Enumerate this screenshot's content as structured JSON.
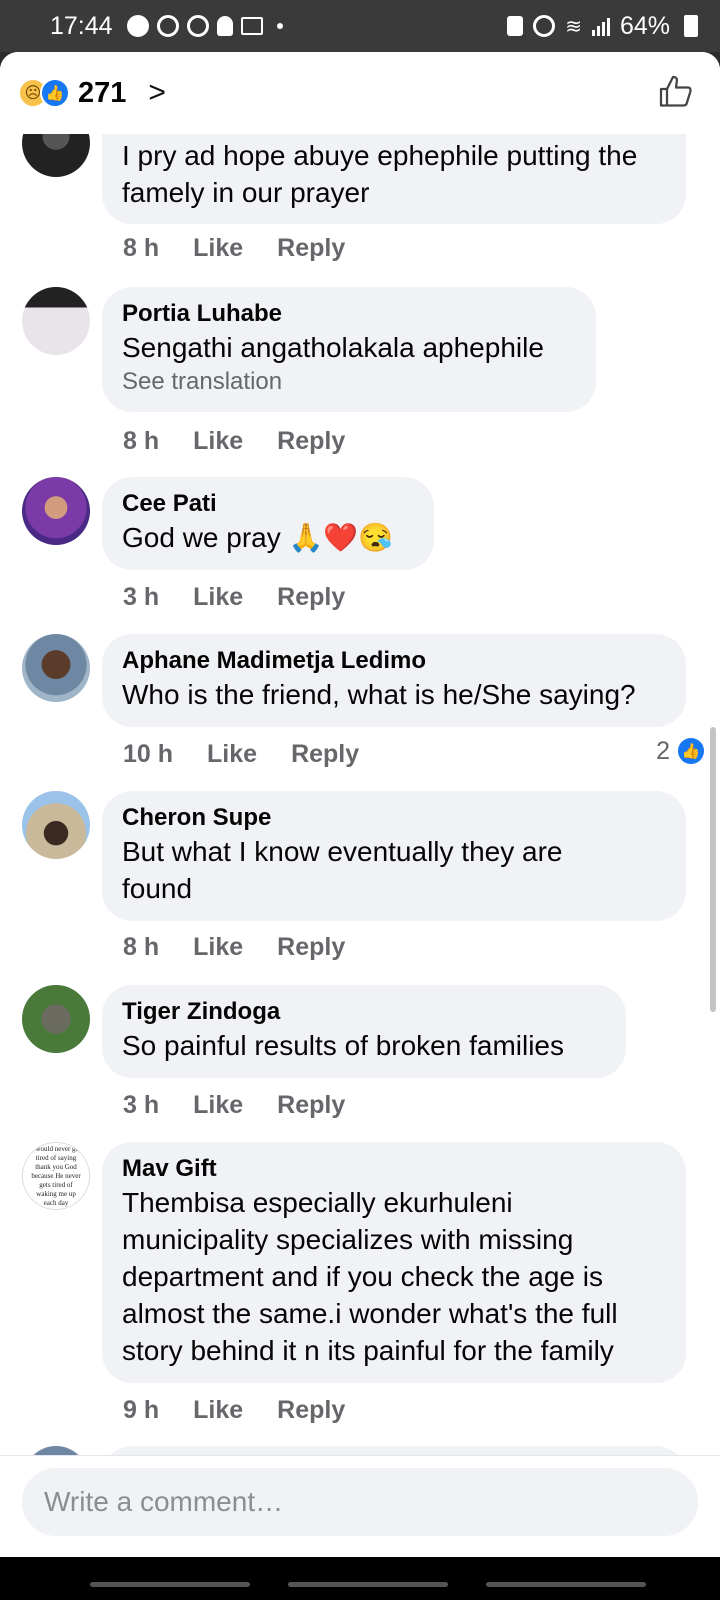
{
  "status_bar": {
    "time": "17:44",
    "battery": "64%"
  },
  "header": {
    "reaction_count": "271",
    "chevron": ">"
  },
  "comments": [
    {
      "author": "",
      "text": "I pry ad hope abuye ephephile putting the famely in our prayer",
      "time": "8 h"
    },
    {
      "author": "Portia Luhabe",
      "text": "Sengathi angatholakala aphephile",
      "see_translation": "See translation",
      "time": "8 h"
    },
    {
      "author": "Cee Pati",
      "text": "God we pray 🙏❤️😪",
      "time": "3 h"
    },
    {
      "author": "Aphane Madimetja Ledimo",
      "text": "Who is the friend, what is he/She saying?",
      "time": "10 h",
      "reactions": "2"
    },
    {
      "author": "Cheron Supe",
      "text": "But what I know eventually they are found",
      "time": "8 h"
    },
    {
      "author": "Tiger Zindoga",
      "text": "So painful results of broken families",
      "time": "3 h"
    },
    {
      "author": "Mav Gift",
      "text": "Thembisa especially ekurhuleni municipality specializes with missing department and if you check the age is almost the same.i wonder what's the full story behind it n its painful for the family",
      "time": "9 h",
      "avatar_text": "I would never get tired of saying thank you God because He never gets tired of waking me up each day"
    }
  ],
  "actions": {
    "like": "Like",
    "reply": "Reply"
  },
  "composer": {
    "placeholder": "Write a comment…"
  },
  "icons": [
    "sad-reaction-icon",
    "like-reaction-icon",
    "chevron-right-icon",
    "thumbs-up-icon"
  ]
}
